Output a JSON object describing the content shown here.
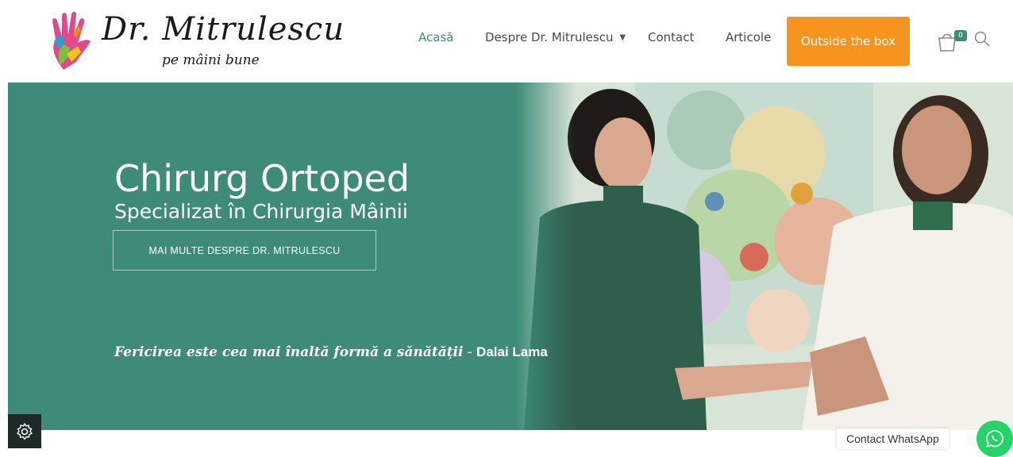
{
  "brand": {
    "title": "Dr. Mitrulescu",
    "tagline": "pe mâini bune"
  },
  "nav": {
    "items": [
      {
        "label": "Acasă",
        "active": true
      },
      {
        "label": "Despre Dr. Mitrulescu",
        "has_dropdown": true
      },
      {
        "label": "Contact"
      },
      {
        "label": "Articole"
      }
    ],
    "cta_label": "Outside the box"
  },
  "cart": {
    "count": "0",
    "icon": "shopping-bag-icon"
  },
  "search": {
    "icon": "search-icon"
  },
  "hero": {
    "title": "Chirurg Ortoped",
    "subtitle": "Specializat în Chirurgia Mâinii",
    "button_label": "MAI MULTE DESPRE DR. MITRULESCU",
    "quote": "Fericirea este cea mai înaltă formă a sănătății",
    "quote_separator": " - ",
    "quote_author": "Dalai Lama"
  },
  "widgets": {
    "settings_icon": "gear-icon",
    "whatsapp_label": "Contact WhatsApp",
    "whatsapp_icon": "whatsapp-icon"
  },
  "colors": {
    "accent": "#3d8b78",
    "cta": "#f7941d",
    "whatsapp": "#25d366"
  }
}
